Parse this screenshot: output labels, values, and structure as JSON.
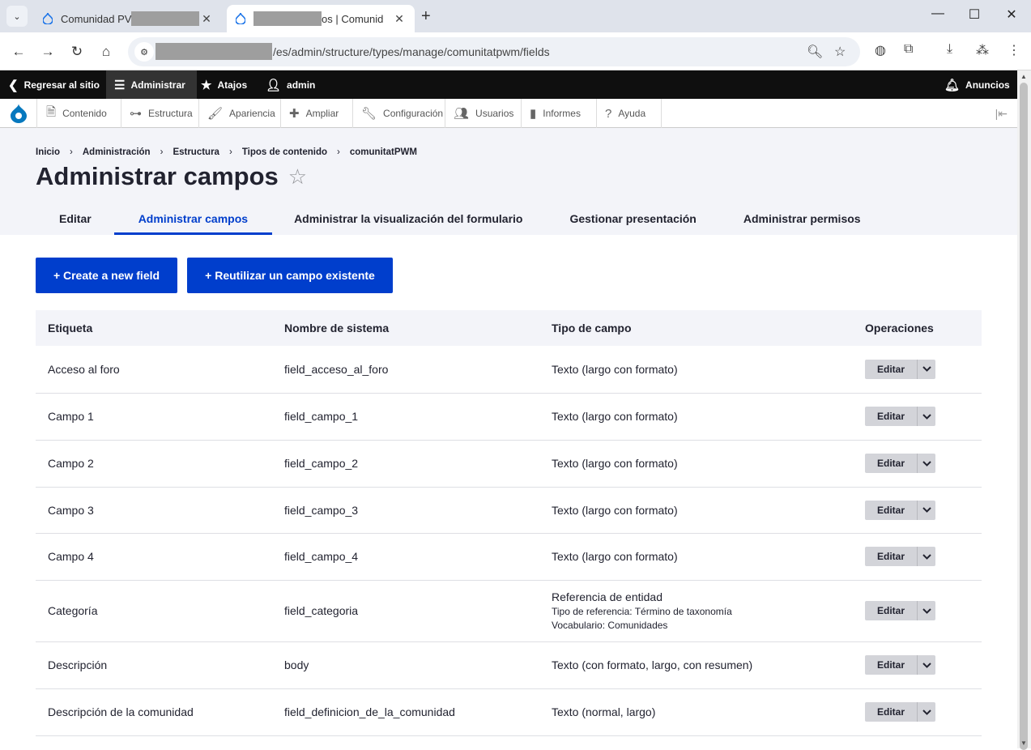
{
  "browser": {
    "tabs": [
      {
        "title_prefix": "Comunidad PV",
        "active": false
      },
      {
        "title_suffix": "os | Comunid",
        "active": true
      }
    ],
    "url_suffix": "/es/admin/structure/types/manage/comunitatpwm/fields",
    "icons": {
      "back": "back-arrow-icon",
      "forward": "forward-arrow-icon",
      "reload": "reload-icon",
      "home": "home-icon",
      "zoom": "zoom-icon",
      "bookmark": "star-icon",
      "extensions": "puzzle-icon",
      "download": "download-icon",
      "menu": "kebab-menu-icon"
    }
  },
  "toolbar": {
    "back_to_site": "Regresar al sitio",
    "manage": "Administrar",
    "shortcuts": "Atajos",
    "user": "admin",
    "announcements": "Anuncios"
  },
  "tray": {
    "items": [
      "Contenido",
      "Estructura",
      "Apariencia",
      "Ampliar",
      "Configuración",
      "Usuarios",
      "Informes",
      "Ayuda"
    ]
  },
  "breadcrumb": [
    "Inicio",
    "Administración",
    "Estructura",
    "Tipos de contenido",
    "comunitatPWM"
  ],
  "page": {
    "title": "Administrar campos",
    "tabs": [
      "Editar",
      "Administrar campos",
      "Administrar la visualización del formulario",
      "Gestionar presentación",
      "Administrar permisos"
    ],
    "active_tab": 1
  },
  "actions": {
    "create": "+ Create a new field",
    "reuse": "+ Reutilizar un campo existente"
  },
  "table": {
    "headers": [
      "Etiqueta",
      "Nombre de sistema",
      "Tipo de campo",
      "Operaciones"
    ],
    "edit_label": "Editar",
    "rows": [
      {
        "label": "Acceso al foro",
        "machine": "field_acceso_al_foro",
        "type": "Texto (largo con formato)"
      },
      {
        "label": "Campo 1",
        "machine": "field_campo_1",
        "type": "Texto (largo con formato)"
      },
      {
        "label": "Campo 2",
        "machine": "field_campo_2",
        "type": "Texto (largo con formato)"
      },
      {
        "label": "Campo 3",
        "machine": "field_campo_3",
        "type": "Texto (largo con formato)"
      },
      {
        "label": "Campo 4",
        "machine": "field_campo_4",
        "type": "Texto (largo con formato)"
      },
      {
        "label": "Categoría",
        "machine": "field_categoria",
        "type": "Referencia de entidad",
        "sub1": "Tipo de referencia: Término de taxonomía",
        "sub2": "Vocabulario: Comunidades"
      },
      {
        "label": "Descripción",
        "machine": "body",
        "type": "Texto (con formato, largo, con resumen)"
      },
      {
        "label": "Descripción de la comunidad",
        "machine": "field_definicion_de_la_comunidad",
        "type": "Texto (normal, largo)"
      }
    ]
  },
  "colors": {
    "accent": "#003ecc",
    "toolbar_bg": "#0f0f0f",
    "header_bg": "#f3f4f9"
  }
}
